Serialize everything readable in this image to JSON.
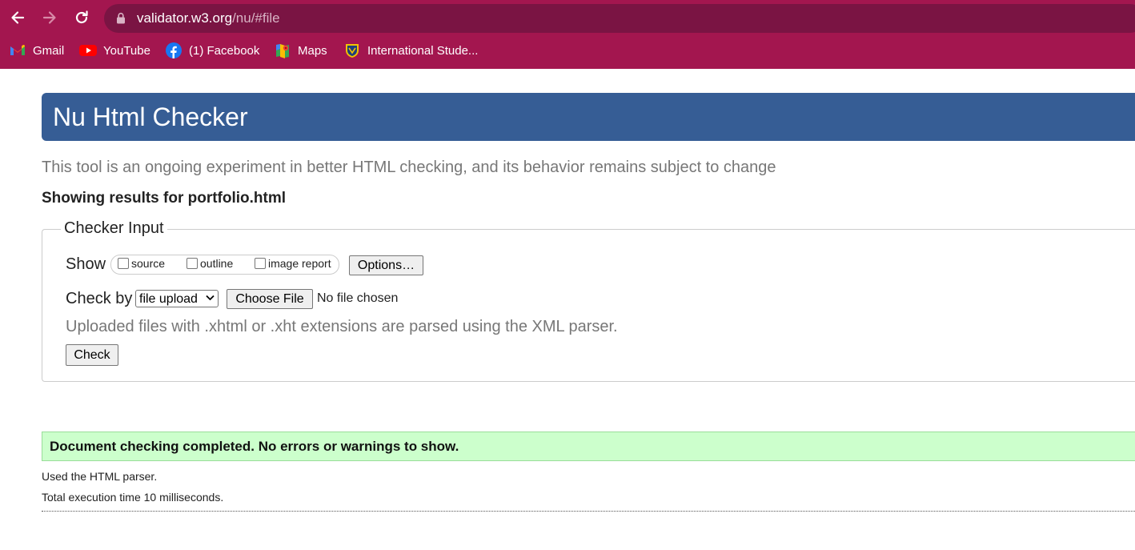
{
  "browser": {
    "url_host": "validator.w3.org",
    "url_path": "/nu/#file",
    "back_icon": "arrow-left-icon",
    "forward_icon": "arrow-right-icon",
    "reload_icon": "reload-icon",
    "lock_icon": "lock-icon",
    "colors": {
      "toolbar": "#a3164f",
      "omnibox": "#7a1443"
    },
    "bookmarks": [
      {
        "label": "Gmail",
        "icon": "gmail-icon"
      },
      {
        "label": "YouTube",
        "icon": "youtube-icon"
      },
      {
        "label": "(1) Facebook",
        "icon": "facebook-icon"
      },
      {
        "label": "Maps",
        "icon": "maps-icon"
      },
      {
        "label": "International Stude...",
        "icon": "shield-crest-icon"
      }
    ]
  },
  "page": {
    "title": "Nu Html Checker",
    "subtitle": "This tool is an ongoing experiment in better HTML checking, and its behavior remains subject to change",
    "results_heading": "Showing results for portfolio.html",
    "colors": {
      "banner": "#365d95",
      "success_bg": "#ccffcc"
    },
    "checker_input": {
      "legend": "Checker Input",
      "show_label": "Show",
      "show_options": [
        {
          "label": "source",
          "checked": false
        },
        {
          "label": "outline",
          "checked": false
        },
        {
          "label": "image report",
          "checked": false
        }
      ],
      "options_button": "Options…",
      "check_by_label": "Check by",
      "check_by_selected": "file upload",
      "choose_file_button": "Choose File",
      "file_status": "No file chosen",
      "hint": "Uploaded files with .xhtml or .xht extensions are parsed using the XML parser.",
      "check_button": "Check"
    },
    "result": {
      "success_message": "Document checking completed. No errors or warnings to show.",
      "parser_note": "Used the HTML parser.",
      "execution_time": "Total execution time 10 milliseconds."
    }
  }
}
